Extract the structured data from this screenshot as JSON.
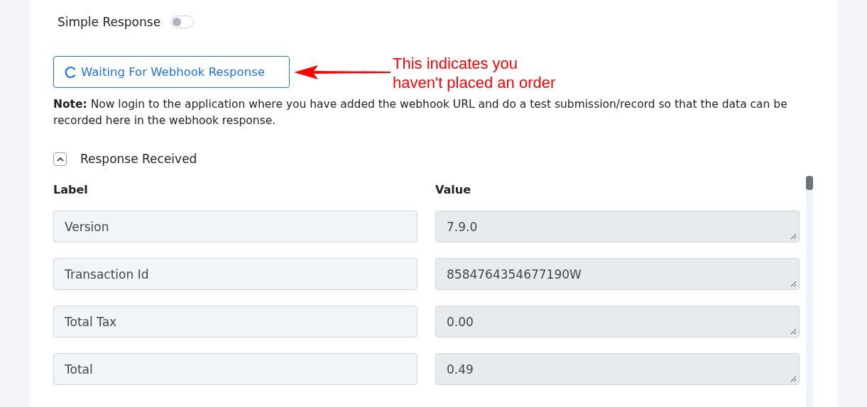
{
  "simple_response": {
    "label": "Simple Response",
    "on": false
  },
  "waiting_button": {
    "label": "Waiting For Webhook Response"
  },
  "annotation": {
    "text": "This indicates you\nhaven't placed an order"
  },
  "note": "**Note:** Now login to the application where you have added the webhook URL and do a test submission/record so that the data can be recorded here in the webhook response.",
  "response_section": {
    "title": "Response Received",
    "expanded": true,
    "columns": [
      "Label",
      "Value"
    ],
    "rows": [
      {
        "label": "Version",
        "value": "7.9.0"
      },
      {
        "label": "Transaction Id",
        "value": "8584764354677190W"
      },
      {
        "label": "Total Tax",
        "value": "0.00"
      },
      {
        "label": "Total",
        "value": "0.49"
      }
    ]
  }
}
